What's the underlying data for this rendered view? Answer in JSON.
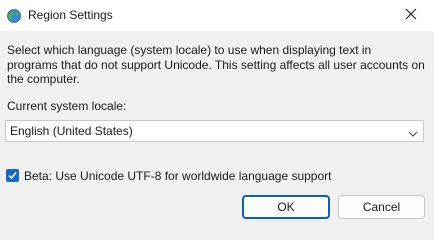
{
  "window": {
    "title": "Region Settings",
    "icon": "globe-icon",
    "close_icon": "close-icon"
  },
  "description": "Select which language (system locale) to use when displaying text in programs that do not support Unicode. This setting affects all user accounts on the computer.",
  "locale": {
    "label": "Current system locale:",
    "selected": "English (United States)",
    "chevron_icon": "chevron-down-icon"
  },
  "beta_option": {
    "label": "Beta: Use Unicode UTF-8 for worldwide language support",
    "checked": true
  },
  "buttons": {
    "ok": "OK",
    "cancel": "Cancel"
  },
  "colors": {
    "accent": "#0b5fc2",
    "checkbox": "#1868c7",
    "dialog_bg": "#f0f0f0",
    "titlebar_bg": "#ffffff"
  }
}
